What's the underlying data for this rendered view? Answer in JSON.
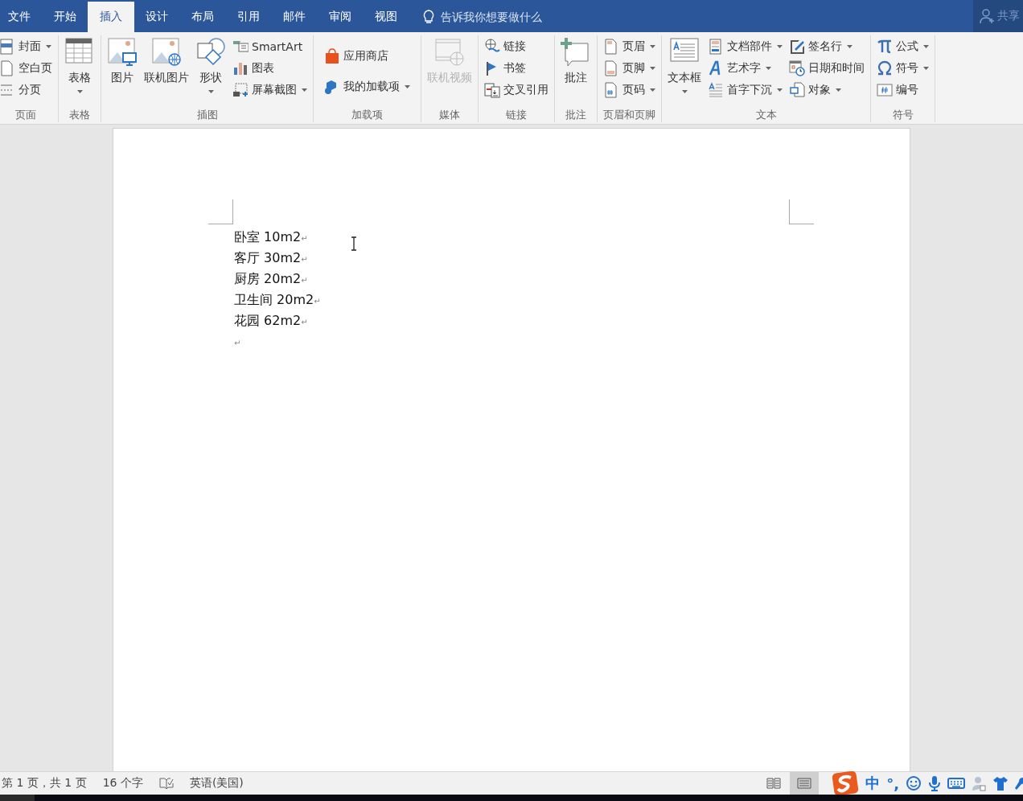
{
  "tabs": [
    {
      "label": "文件",
      "selected": false
    },
    {
      "label": "开始",
      "selected": false
    },
    {
      "label": "插入",
      "selected": true
    },
    {
      "label": "设计",
      "selected": false
    },
    {
      "label": "布局",
      "selected": false
    },
    {
      "label": "引用",
      "selected": false
    },
    {
      "label": "邮件",
      "selected": false
    },
    {
      "label": "审阅",
      "selected": false
    },
    {
      "label": "视图",
      "selected": false
    }
  ],
  "tell_me": {
    "placeholder": "告诉我你想要做什么"
  },
  "share": {
    "label": "共享"
  },
  "ribbon_groups": [
    {
      "label": "页面",
      "columns": [
        {
          "kind": "stack",
          "items": [
            {
              "label": "封面",
              "dropdown": true,
              "disabled": false
            },
            {
              "label": "空白页",
              "dropdown": false,
              "disabled": false
            },
            {
              "label": "分页",
              "dropdown": false,
              "disabled": false
            }
          ]
        }
      ]
    },
    {
      "label": "表格",
      "columns": [
        {
          "kind": "large",
          "items": [
            {
              "label": "表格",
              "dropdown": true,
              "disabled": false
            }
          ]
        }
      ]
    },
    {
      "label": "插图",
      "columns": [
        {
          "kind": "large",
          "items": [
            {
              "label": "图片",
              "dropdown": false,
              "disabled": false
            }
          ]
        },
        {
          "kind": "large",
          "items": [
            {
              "label": "联机图片",
              "dropdown": false,
              "disabled": false
            }
          ]
        },
        {
          "kind": "large",
          "items": [
            {
              "label": "形状",
              "dropdown": true,
              "disabled": false
            }
          ]
        },
        {
          "kind": "stack",
          "items": [
            {
              "label": "SmartArt",
              "dropdown": false,
              "disabled": false
            },
            {
              "label": "图表",
              "dropdown": false,
              "disabled": false
            },
            {
              "label": "屏幕截图",
              "dropdown": true,
              "disabled": false
            }
          ]
        }
      ]
    },
    {
      "label": "加载项",
      "columns": [
        {
          "kind": "stack2",
          "items": [
            {
              "label": "应用商店",
              "dropdown": false,
              "disabled": false
            },
            {
              "label": "我的加载项",
              "dropdown": true,
              "disabled": false
            }
          ]
        }
      ]
    },
    {
      "label": "媒体",
      "columns": [
        {
          "kind": "large",
          "items": [
            {
              "label": "联机视频",
              "dropdown": false,
              "disabled": true
            }
          ]
        }
      ]
    },
    {
      "label": "链接",
      "columns": [
        {
          "kind": "stack",
          "items": [
            {
              "label": "链接",
              "dropdown": false,
              "disabled": false
            },
            {
              "label": "书签",
              "dropdown": false,
              "disabled": false
            },
            {
              "label": "交叉引用",
              "dropdown": false,
              "disabled": false
            }
          ]
        }
      ]
    },
    {
      "label": "批注",
      "columns": [
        {
          "kind": "large",
          "items": [
            {
              "label": "批注",
              "dropdown": false,
              "disabled": false
            }
          ]
        }
      ]
    },
    {
      "label": "页眉和页脚",
      "columns": [
        {
          "kind": "stack",
          "items": [
            {
              "label": "页眉",
              "dropdown": true,
              "disabled": false
            },
            {
              "label": "页脚",
              "dropdown": true,
              "disabled": false
            },
            {
              "label": "页码",
              "dropdown": true,
              "disabled": false
            }
          ]
        }
      ]
    },
    {
      "label": "文本",
      "columns": [
        {
          "kind": "large",
          "items": [
            {
              "label": "文本框",
              "dropdown": true,
              "disabled": false
            }
          ]
        },
        {
          "kind": "stack",
          "items": [
            {
              "label": "文档部件",
              "dropdown": true,
              "disabled": false
            },
            {
              "label": "艺术字",
              "dropdown": true,
              "disabled": false
            },
            {
              "label": "首字下沉",
              "dropdown": true,
              "disabled": false
            }
          ]
        },
        {
          "kind": "stack",
          "items": [
            {
              "label": "签名行",
              "dropdown": true,
              "disabled": false
            },
            {
              "label": "日期和时间",
              "dropdown": false,
              "disabled": false
            },
            {
              "label": "对象",
              "dropdown": true,
              "disabled": false
            }
          ]
        }
      ]
    },
    {
      "label": "符号",
      "columns": [
        {
          "kind": "stack",
          "items": [
            {
              "label": "公式",
              "dropdown": true,
              "disabled": false
            },
            {
              "label": "符号",
              "dropdown": true,
              "disabled": false
            },
            {
              "label": "编号",
              "dropdown": false,
              "disabled": false
            }
          ]
        }
      ]
    }
  ],
  "document": {
    "lines": [
      {
        "text": "卧室 10m2",
        "mark": "↵"
      },
      {
        "text": "客厅 30m2",
        "mark": "↵"
      },
      {
        "text": "厨房 20m2",
        "mark": "↵"
      },
      {
        "text": "卫生间 20m2",
        "mark": "↵"
      },
      {
        "text": "花园 62m2",
        "mark": "↵"
      },
      {
        "mark": "↵"
      }
    ]
  },
  "status_bar": {
    "page": "第 1 页，共 1 页",
    "word_count": "16 个字",
    "language": "英语(美国)",
    "views": [
      {
        "selected": false
      },
      {
        "selected": true
      }
    ],
    "ime": {
      "mode": "中",
      "punct": "°,"
    }
  }
}
